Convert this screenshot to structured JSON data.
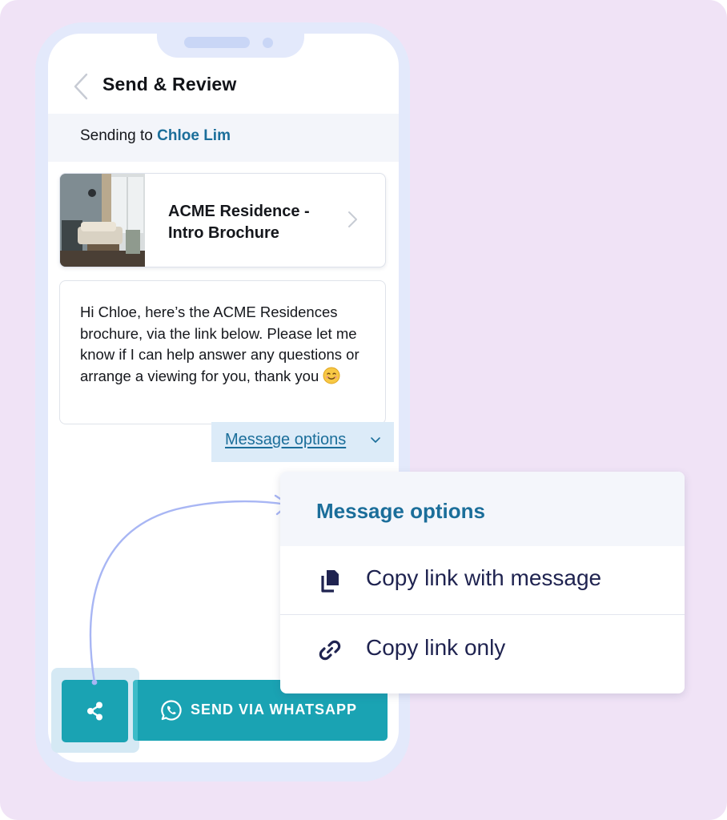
{
  "header": {
    "title": "Send & Review",
    "back_icon": "chevron-left-icon"
  },
  "recipient": {
    "prefix": "Sending to ",
    "name": "Chloe Lim"
  },
  "brochure": {
    "title": "ACME Residence - Intro Brochure",
    "thumbnail": "living-room-photo",
    "chevron_icon": "chevron-right-icon"
  },
  "message": {
    "body": "Hi Chloe, here’s the ACME Residences brochure, via the link below. Please let me know if I can help answer any questions or arrange a viewing for you, thank you",
    "emoji": "smiling-face-emoji"
  },
  "message_options_link": {
    "label": "Message options",
    "caret_icon": "chevron-down-icon"
  },
  "popover": {
    "title": "Message options",
    "items": [
      {
        "label": "Copy link with message",
        "icon": "copy-icon"
      },
      {
        "label": "Copy link only",
        "icon": "link-icon"
      }
    ]
  },
  "buttons": {
    "share_icon": "share-icon",
    "send_label": "SEND VIA WHATSAPP",
    "send_icon": "whatsapp-icon"
  },
  "colors": {
    "background": "#f0e3f6",
    "phone_frame": "#e3e9fb",
    "accent_teal": "#1aa3b3",
    "link_blue": "#1b6e9a",
    "menu_text": "#1f2350",
    "arc": "#a8b6f4"
  }
}
